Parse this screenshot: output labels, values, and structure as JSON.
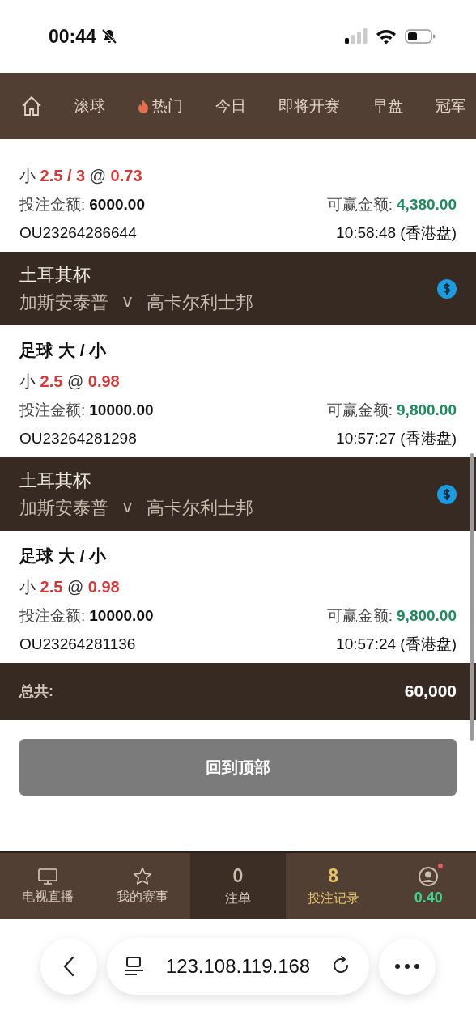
{
  "status_bar": {
    "time": "00:44"
  },
  "nav": {
    "tabs": [
      {
        "kind": "home",
        "selected": false
      },
      {
        "kind": "text",
        "label": "滚球",
        "selected": false
      },
      {
        "kind": "hot",
        "label": "热门",
        "selected": false
      },
      {
        "kind": "text",
        "label": "今日",
        "selected": false
      },
      {
        "kind": "text",
        "label": "即将开赛",
        "selected": false
      },
      {
        "kind": "text",
        "label": "早盘",
        "selected": false
      },
      {
        "kind": "text",
        "label": "冠军",
        "selected": false
      }
    ]
  },
  "entries": [
    {
      "kind": "bet",
      "selection": "小 **2.5 / 3** @ **0.73**",
      "stake_label": "投注金额:",
      "stake": "6000.00",
      "win_label": "可赢金额:",
      "win": "4,380.00",
      "ref": "OU23264286644",
      "time": "10:58:48 (香港盘)"
    },
    {
      "kind": "match",
      "league": "土耳其杯",
      "home": "加斯安泰普",
      "vs": "v",
      "away": "高卡尔利士邦"
    },
    {
      "kind": "bet",
      "title": "足球 大 / 小",
      "selection": "小 **2.5** @ **0.98**",
      "stake_label": "投注金额:",
      "stake": "10000.00",
      "win_label": "可赢金额:",
      "win": "9,800.00",
      "ref": "OU23264281298",
      "time": "10:57:27 (香港盘)"
    },
    {
      "kind": "match",
      "league": "土耳其杯",
      "home": "加斯安泰普",
      "vs": "v",
      "away": "高卡尔利士邦"
    },
    {
      "kind": "bet",
      "title": "足球 大 / 小",
      "selection": "小 **2.5** @ **0.98**",
      "stake_label": "投注金额:",
      "stake": "10000.00",
      "win_label": "可赢金额:",
      "win": "9,800.00",
      "ref": "OU23264281136",
      "time": "10:57:24 (香港盘)"
    }
  ],
  "total": {
    "label": "总共:",
    "value": "60,000"
  },
  "back_to_top": "回到顶部",
  "bottom_nav": [
    {
      "kind": "tv",
      "label": "电视直播",
      "selected": false
    },
    {
      "kind": "star",
      "label": "我的赛事",
      "selected": false
    },
    {
      "kind": "slip",
      "count": "0",
      "label": "注单",
      "selected": false
    },
    {
      "kind": "record",
      "count": "8",
      "label": "投注记录",
      "selected": true
    },
    {
      "kind": "account",
      "balance": "0.40",
      "badge": true,
      "selected": false
    }
  ],
  "browser": {
    "url": "123.108.119.168"
  }
}
